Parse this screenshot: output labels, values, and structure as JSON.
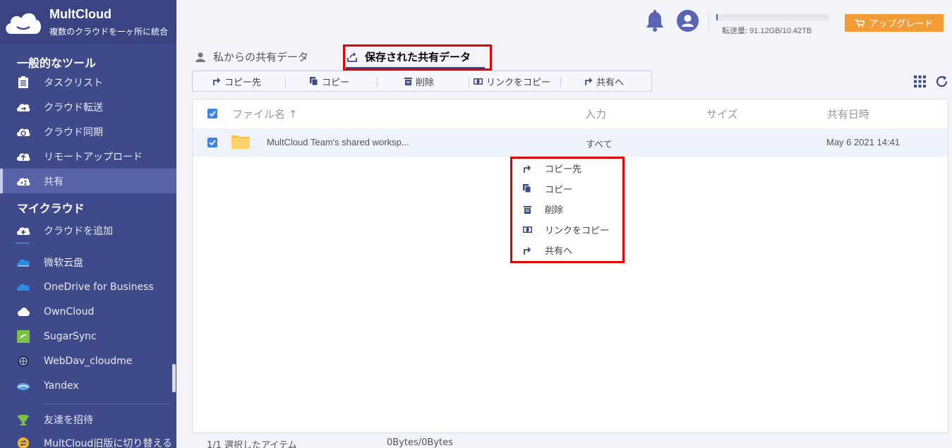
{
  "app": {
    "brand": "MultCloud",
    "tagline": "複数のクラウドを一ヶ所に統合"
  },
  "sidebar": {
    "tools_title": "一般的なツール",
    "tools": [
      {
        "label": "タスクリスト",
        "icon": "task-list-icon"
      },
      {
        "label": "クラウド転送",
        "icon": "cloud-transfer-icon"
      },
      {
        "label": "クラウド同期",
        "icon": "cloud-sync-icon"
      },
      {
        "label": "リモートアップロード",
        "icon": "remote-upload-icon"
      },
      {
        "label": "共有",
        "icon": "share-icon",
        "active": true
      }
    ],
    "clouds_title": "マイクラウド",
    "add_cloud": "クラウドを追加",
    "clouds": [
      {
        "label": "微软云盘",
        "icon": "onedrive-icon"
      },
      {
        "label": "OneDrive for Business",
        "icon": "onedrive-business-icon"
      },
      {
        "label": "OwnCloud",
        "icon": "owncloud-icon"
      },
      {
        "label": "SugarSync",
        "icon": "sugarsync-icon"
      },
      {
        "label": "WebDav_cloudme",
        "icon": "webdav-icon"
      },
      {
        "label": "Yandex",
        "icon": "yandex-icon"
      }
    ],
    "invite": "友達を招待",
    "switch_old": "MultCloud旧版に切り替える"
  },
  "header": {
    "traffic": "転送量: 91.12GB/10.42TB",
    "traffic_fraction": 0.009,
    "upgrade": "アップグレード"
  },
  "tabs": {
    "mine": "私からの共有データ",
    "saved": "保存された共有データ"
  },
  "toolbar": [
    "コピー先",
    "コピー",
    "削除",
    "リンクをコピー",
    "共有へ"
  ],
  "table": {
    "headers": {
      "name": "ファイル名",
      "input": "入力",
      "size": "サイズ",
      "date": "共有日時"
    },
    "rows": [
      {
        "name": "MultCloud Team's shared worksp...",
        "input": "すべて",
        "size": "",
        "date": "May 6 2021 14:41"
      }
    ]
  },
  "context_menu": [
    "コピー先",
    "コピー",
    "削除",
    "リンクをコピー",
    "共有へ"
  ],
  "footer": {
    "selected": "1/1 選択したアイテム",
    "bytes": "0Bytes/0Bytes"
  },
  "colors": {
    "sidebar": "#3f4a8a",
    "accent": "#5965b4",
    "upgrade": "#f29c38",
    "highlight": "#e00000"
  }
}
